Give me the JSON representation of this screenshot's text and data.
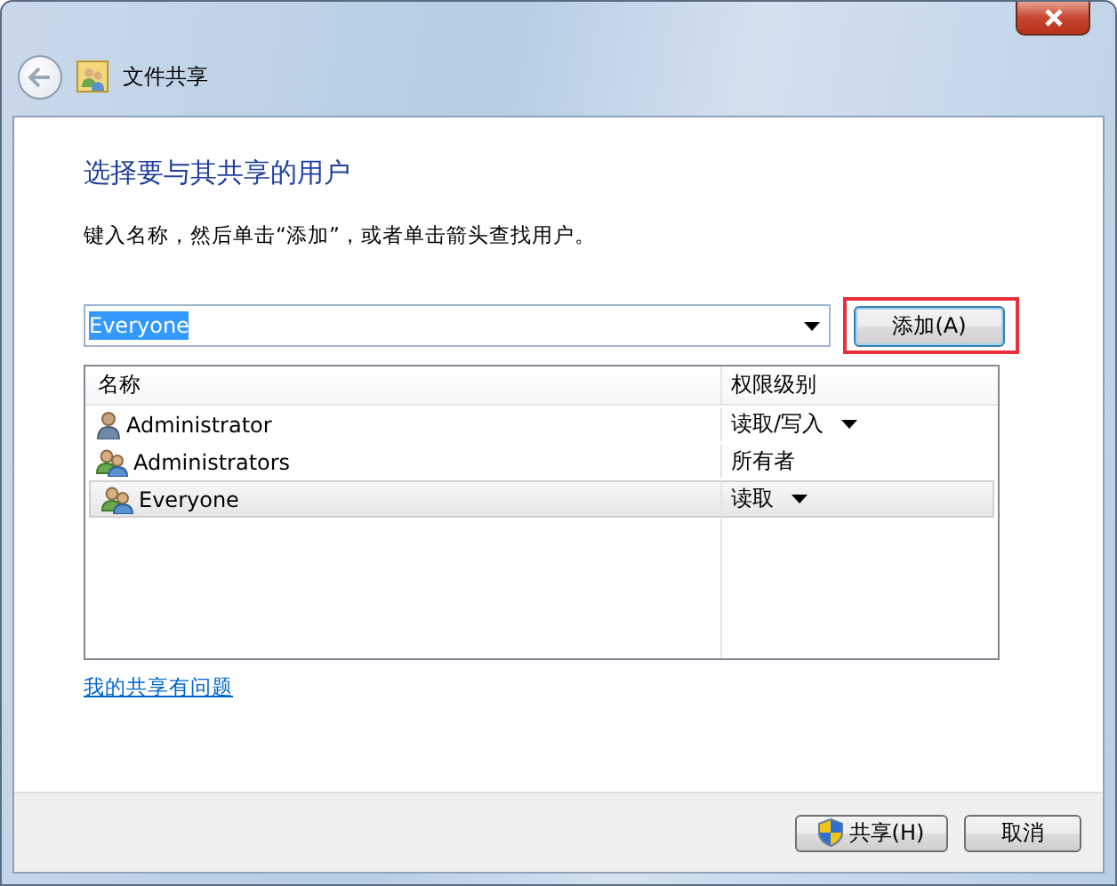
{
  "window": {
    "title": "文件共享"
  },
  "heading": "选择要与其共享的用户",
  "instruction": "键入名称，然后单击“添加”，或者单击箭头查找用户。",
  "name_field": {
    "value": "Everyone",
    "text_selected": true
  },
  "add_button": {
    "label": "添加(A)",
    "highlighted": true
  },
  "table": {
    "columns": [
      "名称",
      "权限级别"
    ],
    "rows": [
      {
        "kind": "user",
        "name": "Administrator",
        "permission": "读取/写入",
        "has_menu": true,
        "selected": false
      },
      {
        "kind": "group",
        "name": "Administrators",
        "permission": "所有者",
        "has_menu": false,
        "selected": false
      },
      {
        "kind": "group",
        "name": "Everyone",
        "permission": "读取",
        "has_menu": true,
        "selected": true
      }
    ]
  },
  "help_link": "我的共享有问题",
  "buttons": [
    {
      "kind": "shield",
      "label": "共享(H)"
    },
    {
      "kind": "plain",
      "label": "取消"
    }
  ]
}
